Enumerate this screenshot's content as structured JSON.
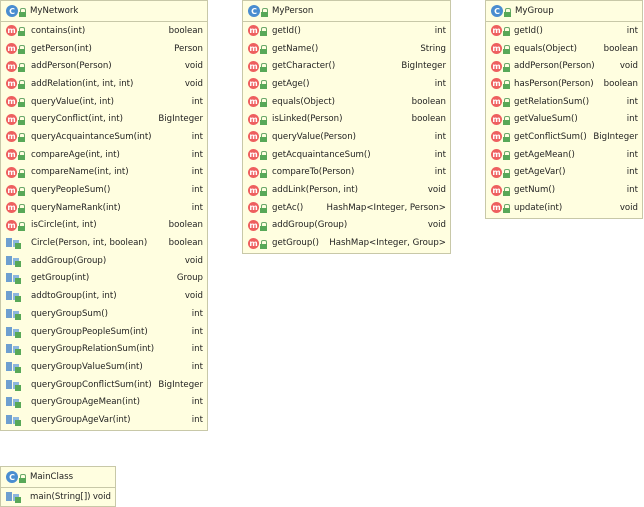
{
  "classes": {
    "mynetwork": {
      "name": "MyNetwork",
      "methods": [
        {
          "sig": "contains(int)",
          "type": "boolean"
        },
        {
          "sig": "getPerson(int)",
          "type": "Person"
        },
        {
          "sig": "addPerson(Person)",
          "type": "void"
        },
        {
          "sig": "addRelation(int, int, int)",
          "type": "void"
        },
        {
          "sig": "queryValue(int, int)",
          "type": "int"
        },
        {
          "sig": "queryConflict(int, int)",
          "type": "BigInteger"
        },
        {
          "sig": "queryAcquaintanceSum(int)",
          "type": "int"
        },
        {
          "sig": "compareAge(int, int)",
          "type": "int"
        },
        {
          "sig": "compareName(int, int)",
          "type": "int"
        },
        {
          "sig": "queryPeopleSum()",
          "type": "int"
        },
        {
          "sig": "queryNameRank(int)",
          "type": "int"
        },
        {
          "sig": "isCircle(int, int)",
          "type": "boolean"
        },
        {
          "sig": "Circle(Person, int, boolean)",
          "type": "boolean"
        },
        {
          "sig": "addGroup(Group)",
          "type": "void"
        },
        {
          "sig": "getGroup(int)",
          "type": "Group"
        },
        {
          "sig": "addtoGroup(int, int)",
          "type": "void"
        },
        {
          "sig": "queryGroupSum()",
          "type": "int"
        },
        {
          "sig": "queryGroupPeopleSum(int)",
          "type": "int"
        },
        {
          "sig": "queryGroupRelationSum(int)",
          "type": "int"
        },
        {
          "sig": "queryGroupValueSum(int)",
          "type": "int"
        },
        {
          "sig": "queryGroupConflictSum(int)",
          "type": "BigInteger"
        },
        {
          "sig": "queryGroupAgeMean(int)",
          "type": "int"
        },
        {
          "sig": "queryGroupAgeVar(int)",
          "type": "int"
        }
      ]
    },
    "myperson": {
      "name": "MyPerson",
      "methods": [
        {
          "sig": "getId()",
          "type": "int"
        },
        {
          "sig": "getName()",
          "type": "String"
        },
        {
          "sig": "getCharacter()",
          "type": "BigInteger"
        },
        {
          "sig": "getAge()",
          "type": "int"
        },
        {
          "sig": "equals(Object)",
          "type": "boolean"
        },
        {
          "sig": "isLinked(Person)",
          "type": "boolean"
        },
        {
          "sig": "queryValue(Person)",
          "type": "int"
        },
        {
          "sig": "getAcquaintanceSum()",
          "type": "int"
        },
        {
          "sig": "compareTo(Person)",
          "type": "int"
        },
        {
          "sig": "addLink(Person, int)",
          "type": "void"
        },
        {
          "sig": "getAc()",
          "type": "HashMap<Integer, Person>"
        },
        {
          "sig": "addGroup(Group)",
          "type": "void"
        },
        {
          "sig": "getGroup()",
          "type": "HashMap<Integer, Group>"
        }
      ]
    },
    "mygroup": {
      "name": "MyGroup",
      "methods": [
        {
          "sig": "getId()",
          "type": "int"
        },
        {
          "sig": "equals(Object)",
          "type": "boolean"
        },
        {
          "sig": "addPerson(Person)",
          "type": "void"
        },
        {
          "sig": "hasPerson(Person)",
          "type": "boolean"
        },
        {
          "sig": "getRelationSum()",
          "type": "int"
        },
        {
          "sig": "getValueSum()",
          "type": "int"
        },
        {
          "sig": "getConflictSum()",
          "type": "BigInteger"
        },
        {
          "sig": "getAgeMean()",
          "type": "int"
        },
        {
          "sig": "getAgeVar()",
          "type": "int"
        },
        {
          "sig": "getNum()",
          "type": "int"
        },
        {
          "sig": "update(int)",
          "type": "void"
        }
      ]
    },
    "mainclass": {
      "name": "MainClass",
      "methods": [
        {
          "sig": "main(String[])",
          "type": "void"
        }
      ]
    }
  },
  "icons": {
    "class": "C",
    "method": "m"
  }
}
